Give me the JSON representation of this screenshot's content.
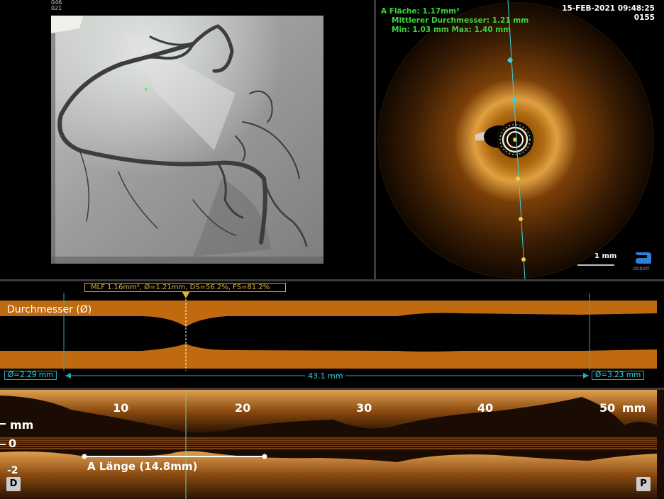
{
  "angio": {
    "corner_tag": "046\n021"
  },
  "oct": {
    "area": "A Fläche: 1.17mm²",
    "mean_diameter": "Mittlerer Durchmesser:  1.21 mm",
    "min_max": "Min:  1.03 mm   Max:  1.40 mm",
    "datetime": "15-FEB-2021 09:48:25",
    "frame": "0155",
    "scale": "1 mm",
    "brand": "Abbott"
  },
  "diameter": {
    "mlf": "MLF 1.16mm², Ø=1.21mm, DS=56.2%, FS=81.2%",
    "title": "Durchmesser (Ø)",
    "left_diam": "Ø=2.29 mm",
    "right_diam": "Ø=3.23 mm",
    "length": "43.1 mm"
  },
  "longitudinal": {
    "ticks": [
      "10",
      "20",
      "30",
      "40",
      "50"
    ],
    "unit": "mm",
    "side_unit": "mm",
    "zero": "0",
    "minus2": "-2",
    "length_label": "A Länge (14.8mm)",
    "btn_distal": "D",
    "btn_proximal": "P"
  },
  "colors": {
    "accent_cyan": "#3ed0e0",
    "orange": "#c06a10",
    "green": "#3cd43c",
    "mlf_gold": "#e0b040"
  }
}
